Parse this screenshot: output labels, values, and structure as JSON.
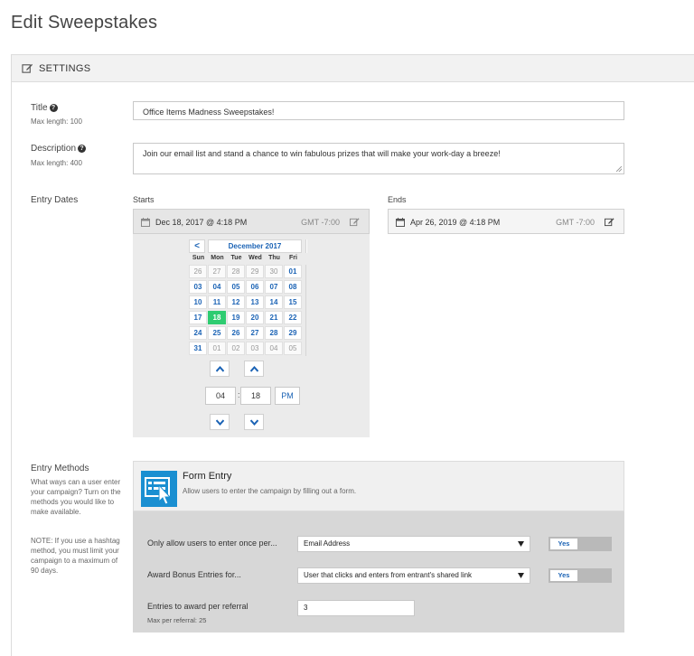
{
  "page": {
    "title": "Edit Sweepstakes"
  },
  "settings": {
    "header": "SETTINGS"
  },
  "title_field": {
    "label": "Title",
    "hint": "Max length: 100",
    "value": "Office Items Madness Sweepstakes!"
  },
  "description_field": {
    "label": "Description",
    "hint": "Max length: 400",
    "value": "Join our email list and stand a chance to win fabulous prizes that will make your work-day a breeze!"
  },
  "entry_dates": {
    "label": "Entry Dates",
    "starts": {
      "label": "Starts",
      "value": "Dec 18, 2017 @ 4:18 PM",
      "timezone": "GMT -7:00"
    },
    "ends": {
      "label": "Ends",
      "value": "Apr 26, 2019 @ 4:18 PM",
      "timezone": "GMT -7:00"
    }
  },
  "calendar": {
    "prev_label": "<",
    "month": "December 2017",
    "weekdays": [
      "Sun",
      "Mon",
      "Tue",
      "Wed",
      "Thu",
      "Fri"
    ],
    "weeks": [
      [
        "26",
        "27",
        "28",
        "29",
        "30",
        "01"
      ],
      [
        "03",
        "04",
        "05",
        "06",
        "07",
        "08"
      ],
      [
        "10",
        "11",
        "12",
        "13",
        "14",
        "15"
      ],
      [
        "17",
        "18",
        "19",
        "20",
        "21",
        "22"
      ],
      [
        "24",
        "25",
        "26",
        "27",
        "28",
        "29"
      ],
      [
        "31",
        "01",
        "02",
        "03",
        "04",
        "05"
      ]
    ],
    "selected": "18"
  },
  "time": {
    "hour": "04",
    "minute": "18",
    "separator": ":",
    "period": "PM"
  },
  "entry_methods": {
    "label": "Entry Methods",
    "hint1": "What ways can a user enter your campaign? Turn on the methods you would like to make available.",
    "hint2": "NOTE: If you use a hashtag method, you must limit your campaign to a maximum of 90 days.",
    "form_entry": {
      "title": "Form Entry",
      "description": "Allow users to enter the campaign by filling out a form.",
      "once_label": "Only allow users to enter once per...",
      "once_value": "Email Address",
      "once_toggle": "Yes",
      "bonus_label": "Award Bonus Entries for...",
      "bonus_value": "User that clicks and enters from entrant's shared link",
      "bonus_toggle": "Yes",
      "referral_label": "Entries to award per referral",
      "referral_value": "3",
      "referral_hint": "Max per referral: 25"
    }
  },
  "colors": {
    "accent": "#1b63b5",
    "selected_day": "#2ecc71",
    "form_icon": "#1a8fd1"
  }
}
